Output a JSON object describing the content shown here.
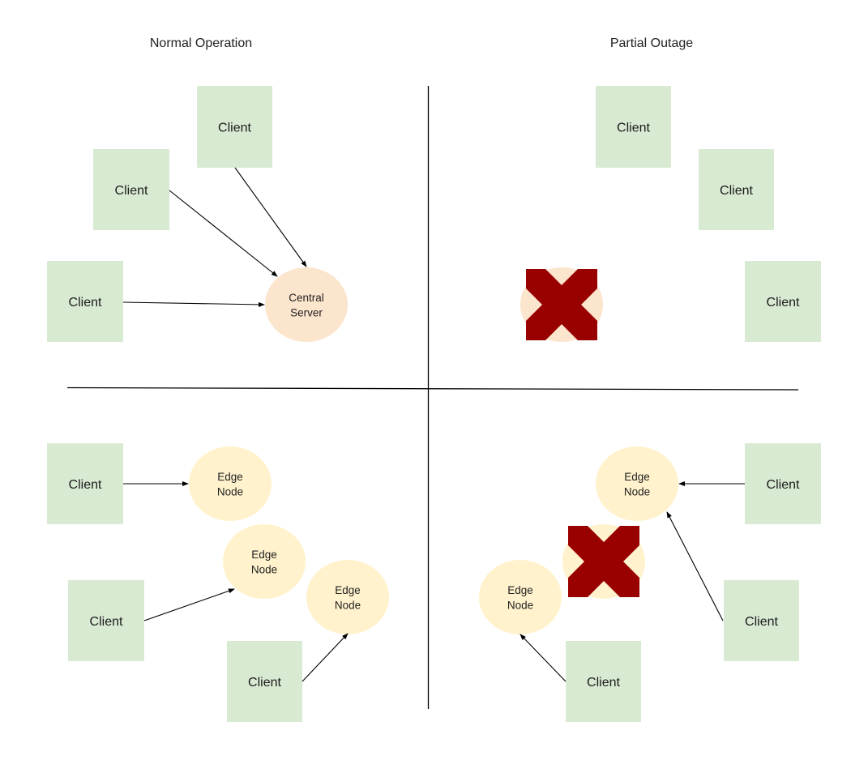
{
  "diagram": {
    "title_left": "Normal Operation",
    "title_right": "Partial Outage",
    "colors": {
      "client_fill": "#d9ead3",
      "central_server_fill": "#fce5cd",
      "edge_node_fill": "#fff2cc",
      "failure_mark": "#990000",
      "line": "#000000",
      "text": "#222222"
    },
    "quadrants": [
      {
        "id": "centralized-normal",
        "description": "Centralized - Normal Operation",
        "clients": [
          {
            "id": "c1",
            "label": "Client"
          },
          {
            "id": "c2",
            "label": "Client"
          },
          {
            "id": "c3",
            "label": "Client"
          }
        ],
        "servers": [
          {
            "id": "s1",
            "label_lines": [
              "Central",
              "Server"
            ],
            "type": "central",
            "status": "up"
          }
        ],
        "connections": [
          {
            "from": "c1",
            "to": "s1"
          },
          {
            "from": "c2",
            "to": "s1"
          },
          {
            "from": "c3",
            "to": "s1"
          }
        ]
      },
      {
        "id": "centralized-outage",
        "description": "Centralized - Partial Outage",
        "clients": [
          {
            "id": "c1",
            "label": "Client"
          },
          {
            "id": "c2",
            "label": "Client"
          },
          {
            "id": "c3",
            "label": "Client"
          }
        ],
        "servers": [
          {
            "id": "s1",
            "label_lines": [],
            "type": "central",
            "status": "failed"
          }
        ],
        "connections": []
      },
      {
        "id": "edge-normal",
        "description": "Edge - Normal Operation",
        "clients": [
          {
            "id": "c1",
            "label": "Client"
          },
          {
            "id": "c2",
            "label": "Client"
          },
          {
            "id": "c3",
            "label": "Client"
          }
        ],
        "servers": [
          {
            "id": "e1",
            "label_lines": [
              "Edge",
              "Node"
            ],
            "type": "edge",
            "status": "up"
          },
          {
            "id": "e2",
            "label_lines": [
              "Edge",
              "Node"
            ],
            "type": "edge",
            "status": "up"
          },
          {
            "id": "e3",
            "label_lines": [
              "Edge",
              "Node"
            ],
            "type": "edge",
            "status": "up"
          }
        ],
        "connections": [
          {
            "from": "c1",
            "to": "e1"
          },
          {
            "from": "c2",
            "to": "e2"
          },
          {
            "from": "c3",
            "to": "e3"
          }
        ]
      },
      {
        "id": "edge-outage",
        "description": "Edge - Partial Outage",
        "clients": [
          {
            "id": "c1",
            "label": "Client"
          },
          {
            "id": "c2",
            "label": "Client"
          },
          {
            "id": "c3",
            "label": "Client"
          }
        ],
        "servers": [
          {
            "id": "e1",
            "label_lines": [
              "Edge",
              "Node"
            ],
            "type": "edge",
            "status": "up"
          },
          {
            "id": "e2",
            "label_lines": [],
            "type": "edge",
            "status": "failed"
          },
          {
            "id": "e3",
            "label_lines": [
              "Edge",
              "Node"
            ],
            "type": "edge",
            "status": "up"
          }
        ],
        "connections": [
          {
            "from": "c1",
            "to": "e1"
          },
          {
            "from": "c2",
            "to": "e1"
          },
          {
            "from": "c3",
            "to": "e3"
          }
        ]
      }
    ]
  }
}
